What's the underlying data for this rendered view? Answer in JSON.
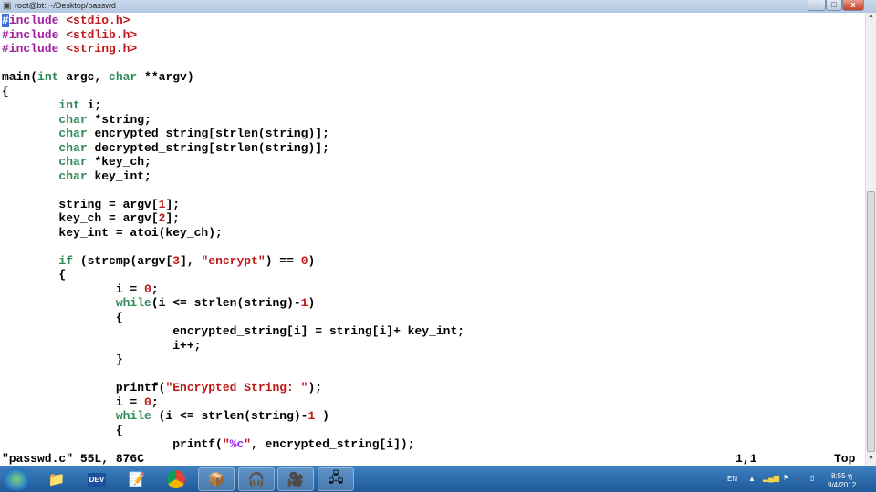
{
  "window": {
    "title": "root@bt: ~/Desktop/passwd",
    "minimize": "–",
    "maximize": "□",
    "close": "x"
  },
  "editor": {
    "lines": [
      [
        [
          "#",
          "cur"
        ],
        [
          "include ",
          "p"
        ],
        [
          "<stdio.h>",
          "s"
        ]
      ],
      [
        [
          "#include ",
          "p"
        ],
        [
          "<stdlib.h>",
          "s"
        ]
      ],
      [
        [
          "#include ",
          "p"
        ],
        [
          "<string.h>",
          "s"
        ]
      ],
      [],
      [
        [
          "main(",
          ""
        ],
        [
          "int",
          "t"
        ],
        [
          " argc, ",
          ""
        ],
        [
          "char",
          "t"
        ],
        [
          " **argv)",
          ""
        ]
      ],
      [
        [
          "{",
          ""
        ]
      ],
      [
        [
          "        ",
          ""
        ],
        [
          "int",
          "t"
        ],
        [
          " i;",
          ""
        ]
      ],
      [
        [
          "        ",
          ""
        ],
        [
          "char",
          "t"
        ],
        [
          " *string;",
          ""
        ]
      ],
      [
        [
          "        ",
          ""
        ],
        [
          "char",
          "t"
        ],
        [
          " encrypted_string[strlen(string)];",
          ""
        ]
      ],
      [
        [
          "        ",
          ""
        ],
        [
          "char",
          "t"
        ],
        [
          " decrypted_string[strlen(string)];",
          ""
        ]
      ],
      [
        [
          "        ",
          ""
        ],
        [
          "char",
          "t"
        ],
        [
          " *key_ch;",
          ""
        ]
      ],
      [
        [
          "        ",
          ""
        ],
        [
          "char",
          "t"
        ],
        [
          " key_int;",
          ""
        ]
      ],
      [],
      [
        [
          "        string = argv[",
          ""
        ],
        [
          "1",
          "s"
        ],
        [
          "];",
          ""
        ]
      ],
      [
        [
          "        key_ch = argv[",
          ""
        ],
        [
          "2",
          "s"
        ],
        [
          "];",
          ""
        ]
      ],
      [
        [
          "        key_int = atoi(key_ch);",
          ""
        ]
      ],
      [],
      [
        [
          "        ",
          ""
        ],
        [
          "if",
          "t"
        ],
        [
          " (strcmp(argv[",
          ""
        ],
        [
          "3",
          "s"
        ],
        [
          "], ",
          ""
        ],
        [
          "\"encrypt\"",
          "s"
        ],
        [
          ") == ",
          ""
        ],
        [
          "0",
          "s"
        ],
        [
          ")",
          ""
        ]
      ],
      [
        [
          "        {",
          ""
        ]
      ],
      [
        [
          "                i = ",
          ""
        ],
        [
          "0",
          "s"
        ],
        [
          ";",
          ""
        ]
      ],
      [
        [
          "                ",
          ""
        ],
        [
          "while",
          "t"
        ],
        [
          "(i <= strlen(string)-",
          ""
        ],
        [
          "1",
          "s"
        ],
        [
          ")",
          ""
        ]
      ],
      [
        [
          "                {",
          ""
        ]
      ],
      [
        [
          "                        encrypted_string[i] = string[i]+ key_int;",
          ""
        ]
      ],
      [
        [
          "                        i++;",
          ""
        ]
      ],
      [
        [
          "                }",
          ""
        ]
      ],
      [],
      [
        [
          "                printf(",
          ""
        ],
        [
          "\"Encrypted String: \"",
          "s"
        ],
        [
          ");",
          ""
        ]
      ],
      [
        [
          "                i = ",
          ""
        ],
        [
          "0",
          "s"
        ],
        [
          ";",
          ""
        ]
      ],
      [
        [
          "                ",
          ""
        ],
        [
          "while",
          "t"
        ],
        [
          " (i <= strlen(string)-",
          ""
        ],
        [
          "1",
          "s"
        ],
        [
          " )",
          ""
        ]
      ],
      [
        [
          "                {",
          ""
        ]
      ],
      [
        [
          "                        printf(",
          ""
        ],
        [
          "\"",
          "s"
        ],
        [
          "%c",
          "sp"
        ],
        [
          "\"",
          "s"
        ],
        [
          ", encrypted_string[i]);",
          ""
        ]
      ]
    ]
  },
  "status": {
    "file": "\"passwd.c\" 55L, 876C",
    "position": "1,1",
    "scroll": "Top"
  },
  "taskbar": {
    "apps": [
      "windows-explorer",
      "dev-cpp",
      "notepad-plus-plus",
      "chrome",
      "virtualbox",
      "audacity",
      "camtasia",
      "remote-desktop"
    ]
  },
  "tray": {
    "language": "EN",
    "time": "8:55 ทุ",
    "date": "9/4/2012"
  }
}
